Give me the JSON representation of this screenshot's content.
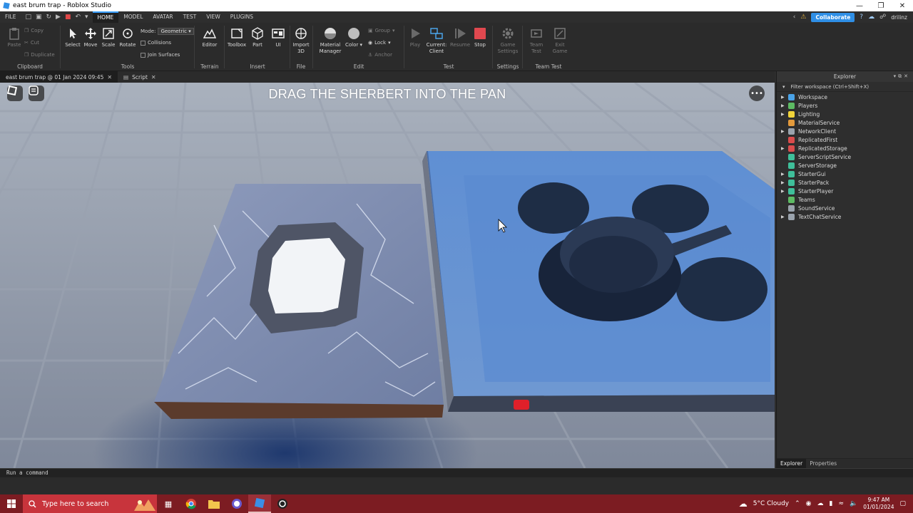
{
  "window": {
    "title": "east brum trap - Roblox Studio"
  },
  "menu": {
    "file": "FILE",
    "tabs": [
      "HOME",
      "MODEL",
      "AVATAR",
      "TEST",
      "VIEW",
      "PLUGINS"
    ],
    "active_tab": "HOME",
    "collaborate": "Collaborate",
    "username": "drilinz"
  },
  "ribbon": {
    "clipboard": {
      "label": "Clipboard",
      "paste": "Paste",
      "copy": "Copy",
      "cut": "Cut",
      "duplicate": "Duplicate"
    },
    "tools": {
      "label": "Tools",
      "select": "Select",
      "move": "Move",
      "scale": "Scale",
      "rotate": "Rotate",
      "mode_label": "Mode:",
      "mode_value": "Geometric",
      "collisions": "Collisions",
      "join_surfaces": "Join Surfaces"
    },
    "terrain": {
      "label": "Terrain",
      "editor": "Editor"
    },
    "insert": {
      "label": "Insert",
      "toolbox": "Toolbox",
      "part": "Part",
      "ui": "UI"
    },
    "file": {
      "label": "File",
      "import3d_1": "Import",
      "import3d_2": "3D"
    },
    "edit": {
      "label": "Edit",
      "material_1": "Material",
      "material_2": "Manager",
      "color": "Color",
      "group": "Group",
      "lock": "Lock",
      "anchor": "Anchor"
    },
    "test": {
      "label": "Test",
      "play": "Play",
      "current_1": "Current:",
      "current_2": "Client",
      "resume": "Resume",
      "stop": "Stop"
    },
    "settings": {
      "label": "Settings",
      "game_1": "Game",
      "game_2": "Settings"
    },
    "teamtest": {
      "label": "Team Test",
      "team_1": "Team",
      "team_2": "Test",
      "exit_1": "Exit",
      "exit_2": "Game"
    }
  },
  "doc_tabs": [
    {
      "label": "east brum trap @ 01 Jan 2024 09:45"
    },
    {
      "label": "Script"
    }
  ],
  "viewport": {
    "overlay_text": "DRAG THE SHERBERT INTO THE PAN"
  },
  "explorer": {
    "title": "Explorer",
    "filter_placeholder": "Filter workspace (Ctrl+Shift+X)",
    "items": [
      {
        "label": "Workspace",
        "expandable": true,
        "color": "#4aa3e8"
      },
      {
        "label": "Players",
        "expandable": true,
        "color": "#5dbb63"
      },
      {
        "label": "Lighting",
        "expandable": true,
        "color": "#f2d43a"
      },
      {
        "label": "MaterialService",
        "expandable": false,
        "color": "#e39a3c"
      },
      {
        "label": "NetworkClient",
        "expandable": true,
        "color": "#9aa3ad"
      },
      {
        "label": "ReplicatedFirst",
        "expandable": false,
        "color": "#d94c4c"
      },
      {
        "label": "ReplicatedStorage",
        "expandable": true,
        "color": "#d94c4c"
      },
      {
        "label": "ServerScriptService",
        "expandable": false,
        "color": "#3fbf9a"
      },
      {
        "label": "ServerStorage",
        "expandable": false,
        "color": "#3fbf9a"
      },
      {
        "label": "StarterGui",
        "expandable": true,
        "color": "#3fbf9a"
      },
      {
        "label": "StarterPack",
        "expandable": true,
        "color": "#3fbf9a"
      },
      {
        "label": "StarterPlayer",
        "expandable": true,
        "color": "#3fbf9a"
      },
      {
        "label": "Teams",
        "expandable": false,
        "color": "#5dbb63"
      },
      {
        "label": "SoundService",
        "expandable": false,
        "color": "#9aa3ad"
      },
      {
        "label": "TextChatService",
        "expandable": true,
        "color": "#9aa3ad"
      }
    ],
    "bottom_tabs": [
      "Explorer",
      "Properties"
    ]
  },
  "command_bar": {
    "placeholder": "Run a command"
  },
  "taskbar": {
    "search_placeholder": "Type here to search",
    "weather": "5°C  Cloudy",
    "time": "9:47 AM",
    "date": "01/01/2024"
  }
}
